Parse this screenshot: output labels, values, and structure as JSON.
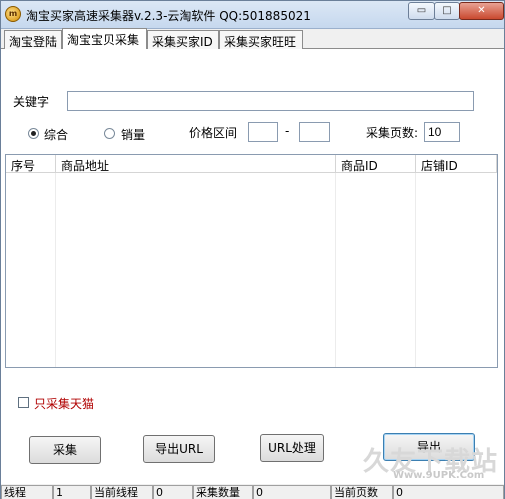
{
  "window": {
    "title": "淘宝买家高速采集器v.2.3-云淘软件 QQ:501885021",
    "min_glyph": "▭",
    "max_glyph": "□",
    "close_glyph": "✕"
  },
  "tabs": [
    {
      "label": "淘宝登陆"
    },
    {
      "label": "淘宝宝贝采集",
      "active": true
    },
    {
      "label": "采集买家ID"
    },
    {
      "label": "采集买家旺旺"
    }
  ],
  "form": {
    "keyword_label": "关键字",
    "keyword_value": "",
    "radio_comprehensive": "综合",
    "radio_sales": "销量",
    "selected_sort": "综合",
    "price_label": "价格区间",
    "price_min": "",
    "price_sep": "-",
    "price_max": "",
    "pages_label": "采集页数:",
    "pages_value": "10"
  },
  "table": {
    "columns": [
      "序号",
      "商品地址",
      "商品ID",
      "店铺ID"
    ],
    "rows": []
  },
  "only_tmall_label": "只采集天猫",
  "only_tmall_checked": false,
  "buttons": {
    "collect": "采集",
    "export_url": "导出URL",
    "url_process": "URL处理",
    "export": "导出"
  },
  "status": {
    "threads_label": "线程",
    "threads_value": "1",
    "current_thread_label": "当前线程",
    "current_thread_value": "0",
    "collected_label": "采集数量",
    "collected_value": "0",
    "current_page_label": "当前页数",
    "current_page_value": "0"
  },
  "watermark": {
    "text": "久友下载站",
    "url": "Www.9UPK.Com"
  },
  "colors": {
    "accent_red": "#b00000",
    "titlebar": "#c6d8ee"
  }
}
